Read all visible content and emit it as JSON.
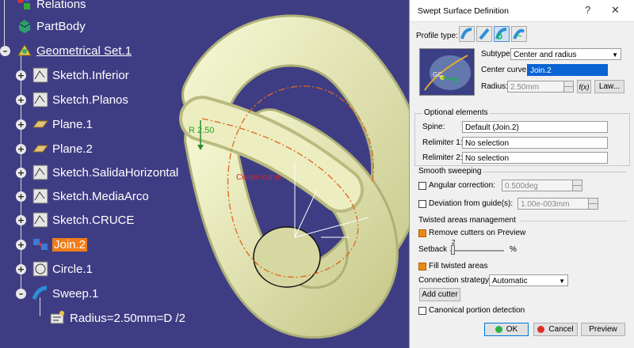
{
  "tree": {
    "items": [
      {
        "label": "Relations"
      },
      {
        "label": "PartBody"
      },
      {
        "label": "Geometrical Set.1"
      },
      {
        "label": "Sketch.Inferior"
      },
      {
        "label": "Sketch.Planos"
      },
      {
        "label": "Plane.1"
      },
      {
        "label": "Plane.2"
      },
      {
        "label": "Sketch.SalidaHorizontal"
      },
      {
        "label": "Sketch.MediaArco"
      },
      {
        "label": "Sketch.CRUCE"
      },
      {
        "label": "Join.2"
      },
      {
        "label": "Circle.1"
      },
      {
        "label": "Sweep.1"
      },
      {
        "label": "Radius=2.50mm=D /2"
      }
    ]
  },
  "viewport": {
    "radius_label": "R 2.50",
    "center_curve_label": "Center curve"
  },
  "dialog": {
    "title": "Swept Surface Definition",
    "help": "?",
    "close": "✕",
    "profile_type_label": "Profile type:",
    "preview_gc": "GC",
    "preview_r": "R",
    "subtype_label": "Subtype:",
    "subtype_value": "Center and radius",
    "center_curve_label": "Center curve:",
    "center_curve_value": "Join.2",
    "radius_label": "Radius:",
    "radius_value": "2.50mm",
    "law_button": "Law...",
    "formula_button": "f(x)",
    "optional_elements": "Optional elements",
    "spine_label": "Spine:",
    "spine_value": "Default (Join.2)",
    "relimiter1_label": "Relimiter 1:",
    "relimiter1_value": "No selection",
    "relimiter2_label": "Relimiter 2:",
    "relimiter2_value": "No selection",
    "smooth_sweeping": "Smooth sweeping",
    "angular_correction_label": "Angular correction:",
    "angular_correction_value": "0.500deg",
    "deviation_label": "Deviation from guide(s):",
    "deviation_value": "1.00e-003mm",
    "twisted_areas": "Twisted areas management",
    "remove_cutters": "Remove cutters on Preview",
    "setback_label": "Setback",
    "setback_value": "2",
    "setback_unit": "%",
    "fill_twisted": "Fill twisted areas",
    "connection_strategy_label": "Connection strategy:",
    "connection_strategy_value": "Automatic",
    "add_cutter": "Add cutter",
    "canonical": "Canonical portion detection",
    "ok": "OK",
    "cancel": "Cancel",
    "preview": "Preview"
  },
  "colors": {
    "background": "#3e3d84",
    "tube": "#e9ebbb",
    "selection": "#f07d19",
    "accent": "#0a64d2"
  }
}
